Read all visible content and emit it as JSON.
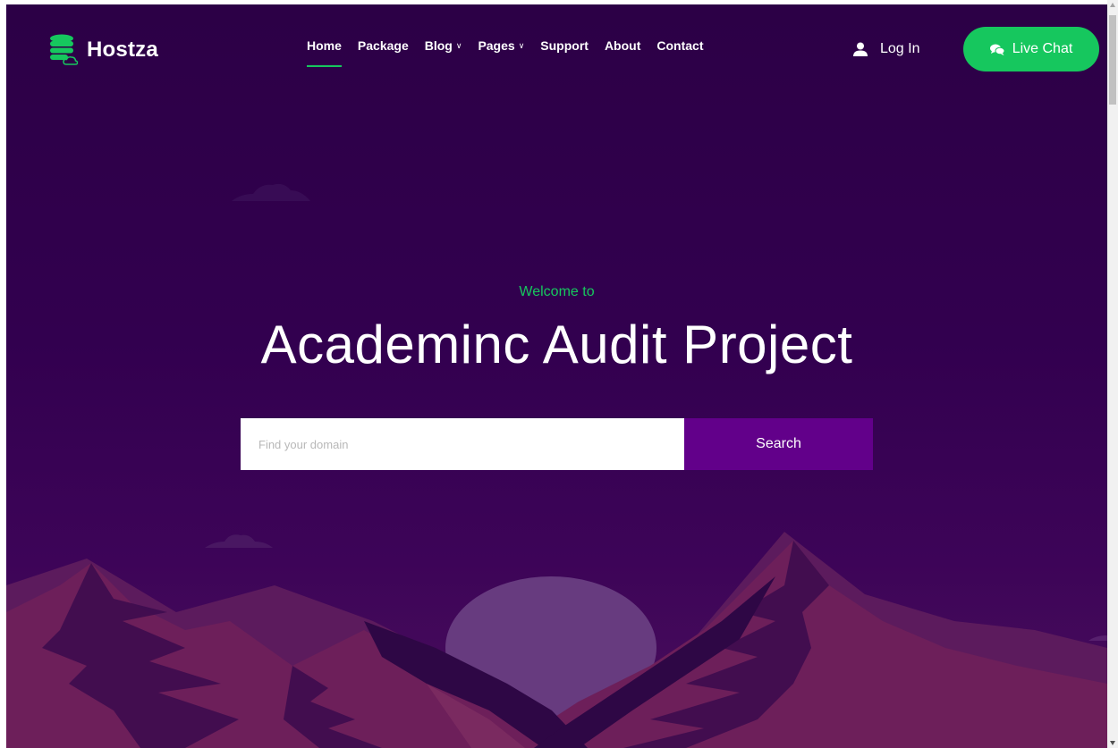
{
  "brand": {
    "name": "Hostza",
    "accent_color": "#16c75e",
    "icon": "database-cloud-icon"
  },
  "nav": {
    "items": [
      {
        "label": "Home",
        "active": true,
        "dropdown": false
      },
      {
        "label": "Package",
        "active": false,
        "dropdown": false
      },
      {
        "label": "Blog",
        "active": false,
        "dropdown": true
      },
      {
        "label": "Pages",
        "active": false,
        "dropdown": true
      },
      {
        "label": "Support",
        "active": false,
        "dropdown": false
      },
      {
        "label": "About",
        "active": false,
        "dropdown": false
      },
      {
        "label": "Contact",
        "active": false,
        "dropdown": false
      }
    ]
  },
  "header": {
    "login_label": "Log In",
    "login_icon": "user-icon",
    "chat_label": "Live Chat",
    "chat_icon": "chat-bubbles-icon"
  },
  "hero": {
    "welcome": "Welcome to",
    "title": "Academinc Audit Project",
    "search_placeholder": "Find your domain",
    "search_value": "",
    "search_button": "Search",
    "search_button_color": "#62008a"
  }
}
